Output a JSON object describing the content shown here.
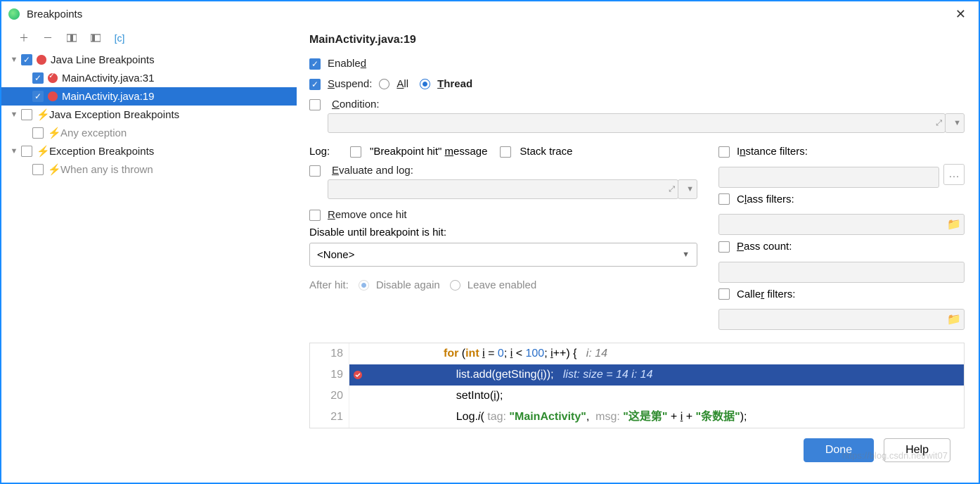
{
  "window": {
    "title": "Breakpoints"
  },
  "tree": {
    "java_line": {
      "label": "Java Line Breakpoints",
      "items": [
        {
          "label": "MainActivity.java:31"
        },
        {
          "label": "MainActivity.java:19"
        }
      ]
    },
    "java_exc": {
      "label": "Java Exception Breakpoints",
      "any": "Any exception"
    },
    "exc": {
      "label": "Exception Breakpoints",
      "when": "When any is thrown"
    }
  },
  "detail": {
    "title": "MainActivity.java:19",
    "enabled": "Enabled",
    "suspend": "Suspend:",
    "all": "All",
    "thread": "Thread",
    "condition": "Condition:",
    "log": "Log:",
    "bp_hit": "\"Breakpoint hit\" message",
    "stack": "Stack trace",
    "eval": "Evaluate and log:",
    "remove": "Remove once hit",
    "disable_until": "Disable until breakpoint is hit:",
    "none": "<None>",
    "after_hit": "After hit:",
    "disable_again": "Disable again",
    "leave": "Leave enabled",
    "instance": "Instance filters:",
    "class": "Class filters:",
    "pass": "Pass count:",
    "caller": "Caller filters:"
  },
  "code": {
    "l18_no": "18",
    "l18": "for (int i = 0; i < 100; i++) {",
    "l18_hint": "i: 14",
    "l19_no": "19",
    "l19": "list.add(getSting(i));",
    "l19_hint": "list:  size = 14  i: 14",
    "l20_no": "20",
    "l20": "setInto(i);",
    "l21_no": "21",
    "l21_a": "Log.i(",
    "l21_tag": "tag:",
    "l21_tagv": "\"MainActivity\"",
    "l21_msg": "msg:",
    "l21_s1": "\"这是第\"",
    "l21_plus": " + ",
    "l21_i": "i",
    "l21_s2": "\"条数据\"",
    "l21_end": ");"
  },
  "footer": {
    "done": "Done",
    "help": "Help"
  },
  "watermark": "https://blog.csdn.net/wit07"
}
